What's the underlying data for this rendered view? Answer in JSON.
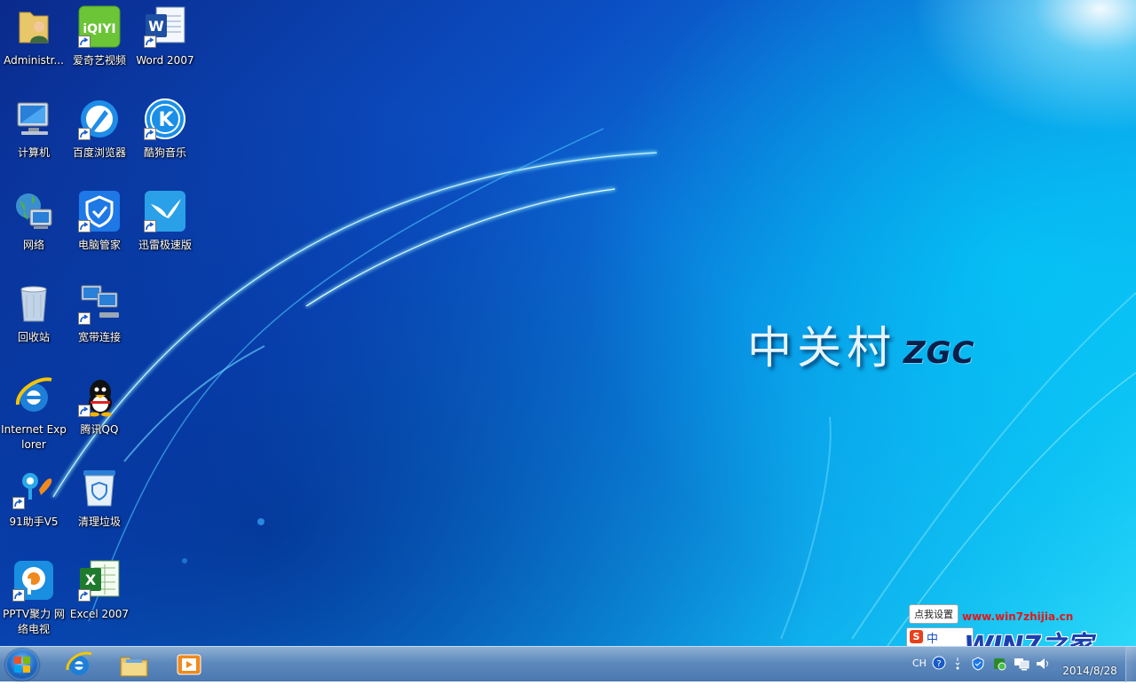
{
  "desktop": {
    "logo_cn": "中关村",
    "logo_en": "ZGC",
    "icons": [
      {
        "label": "Administr...",
        "icon": "user-folder-icon"
      },
      {
        "label": "爱奇艺视频",
        "icon": "iqiyi-icon"
      },
      {
        "label": "Word 2007",
        "icon": "word-icon"
      },
      {
        "label": "计算机",
        "icon": "computer-icon"
      },
      {
        "label": "百度浏览器",
        "icon": "baidu-browser-icon"
      },
      {
        "label": "酷狗音乐",
        "icon": "kugou-icon"
      },
      {
        "label": "网络",
        "icon": "network-icon"
      },
      {
        "label": "电脑管家",
        "icon": "pc-manager-icon"
      },
      {
        "label": "迅雷极速版",
        "icon": "thunder-icon"
      },
      {
        "label": "回收站",
        "icon": "recycle-bin-icon"
      },
      {
        "label": "宽带连接",
        "icon": "broadband-icon"
      },
      {
        "label": "Internet Explorer",
        "icon": "ie-icon"
      },
      {
        "label": "腾讯QQ",
        "icon": "qq-icon"
      },
      {
        "label": "91助手V5",
        "icon": "91-assistant-icon"
      },
      {
        "label": "清理垃圾",
        "icon": "clean-trash-icon"
      },
      {
        "label": "PPTV聚力 网络电视",
        "icon": "pptv-icon"
      },
      {
        "label": "Excel 2007",
        "icon": "excel-icon"
      }
    ]
  },
  "watermark": {
    "tooltip": "点我设置",
    "url": "www.win7zhijia.cn",
    "logo": "WIN7之家",
    "ime_badge": "S",
    "ime_mode": "中"
  },
  "taskbar": {
    "pinned": [
      "start-orb-icon",
      "ie-icon",
      "explorer-icon",
      "media-player-icon"
    ],
    "tray": {
      "language": "CH",
      "date": "2014/8/28"
    }
  },
  "colors": {
    "accent": "#0b4fc4",
    "taskbar": "#5d89bd",
    "url_red": "#e01818"
  }
}
